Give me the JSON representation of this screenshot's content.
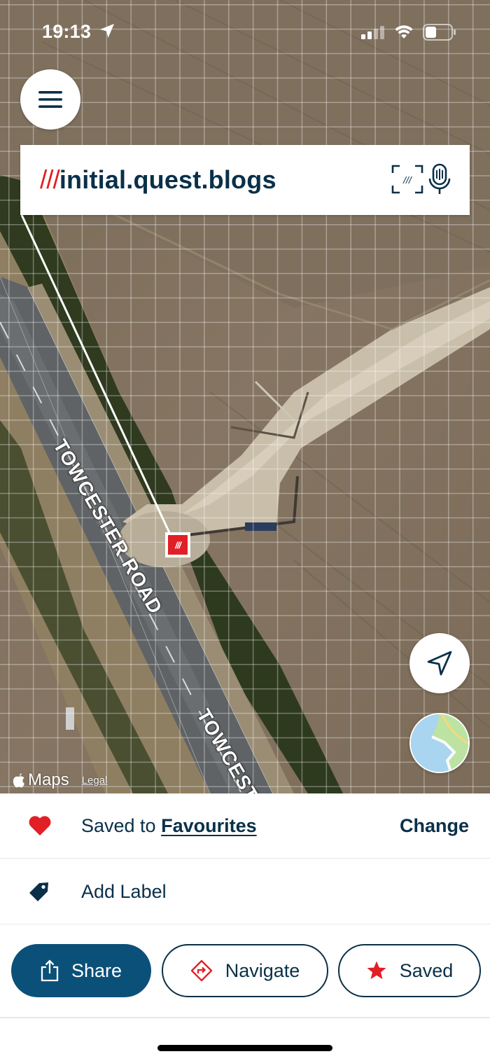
{
  "status_bar": {
    "time": "19:13"
  },
  "search": {
    "slashes": "///",
    "address": "initial.quest.blogs"
  },
  "map": {
    "road_labels": [
      "TOWCESTER ROAD",
      "TOWCESTER"
    ],
    "pin_label": "///",
    "attribution": {
      "brand": "Maps",
      "legal": "Legal"
    }
  },
  "sheet": {
    "favourites": {
      "prefix": "Saved to ",
      "list_name": "Favourites",
      "change_label": "Change"
    },
    "label_row": {
      "text": "Add Label"
    },
    "actions": {
      "share": "Share",
      "navigate": "Navigate",
      "saved": "Saved"
    }
  },
  "colors": {
    "brand_red": "#e11f26",
    "navy": "#0a3049",
    "share_blue": "#0b5078"
  },
  "icons": [
    "location-arrow-icon",
    "signal-icon",
    "wifi-icon",
    "battery-icon",
    "menu-icon",
    "scan-icon",
    "microphone-icon",
    "compass-arrow-icon",
    "map-type-icon",
    "heart-icon",
    "tag-icon",
    "share-icon",
    "navigate-icon",
    "star-icon"
  ]
}
